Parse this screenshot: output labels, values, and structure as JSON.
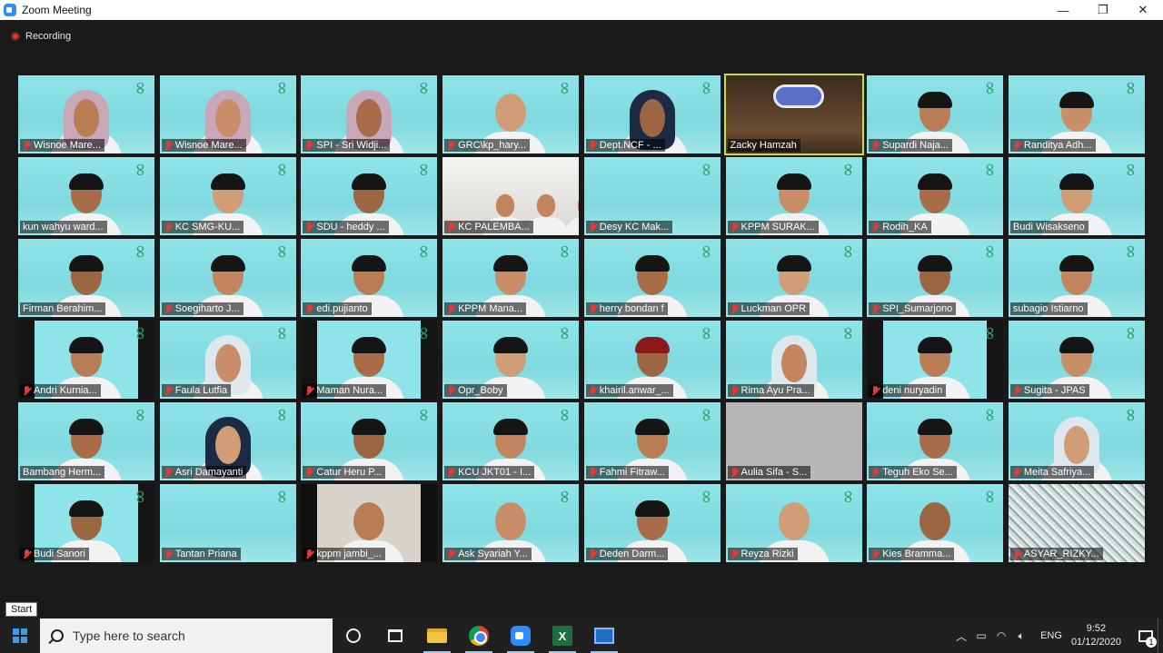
{
  "window": {
    "title": "Zoom Meeting",
    "controls": {
      "minimize": "—",
      "restore": "❐",
      "close": "✕"
    }
  },
  "recording": {
    "label": "Recording"
  },
  "participants": [
    {
      "name": "Wisnoe Mare...",
      "muted": true,
      "look": "hijab"
    },
    {
      "name": "Wisnoe Mare...",
      "muted": true,
      "look": "hijab"
    },
    {
      "name": "SPI - Sri Widji...",
      "muted": true,
      "look": "hijab"
    },
    {
      "name": "GRC\\kp_hary...",
      "muted": true,
      "look": "bare"
    },
    {
      "name": "Dept.NCF - ...",
      "muted": true,
      "look": "hijab-dark"
    },
    {
      "name": "Zacky Hamzah",
      "muted": false,
      "look": "askrindo",
      "active": true
    },
    {
      "name": "Supardi Naja...",
      "muted": true,
      "look": "cap"
    },
    {
      "name": "Randitya Adh...",
      "muted": true,
      "look": "cap"
    },
    {
      "name": "kun wahyu ward...",
      "muted": false,
      "look": "cap"
    },
    {
      "name": "KC SMG-KU...",
      "muted": true,
      "look": "cap"
    },
    {
      "name": "SDU - heddy ...",
      "muted": true,
      "look": "cap"
    },
    {
      "name": "KC PALEMBA...",
      "muted": true,
      "look": "group"
    },
    {
      "name": "Desy KC Mak...",
      "muted": true,
      "look": "empty"
    },
    {
      "name": "KPPM SURAK...",
      "muted": true,
      "look": "cap"
    },
    {
      "name": "Rodih_KA",
      "muted": true,
      "look": "cap"
    },
    {
      "name": "Budi Wisakseno",
      "muted": false,
      "look": "cap"
    },
    {
      "name": "Firman Berahim...",
      "muted": false,
      "look": "cap"
    },
    {
      "name": "Soegiharto J...",
      "muted": true,
      "look": "cap"
    },
    {
      "name": "edi.pujianto",
      "muted": true,
      "look": "cap"
    },
    {
      "name": "KPPM Mana...",
      "muted": true,
      "look": "cap"
    },
    {
      "name": "herry bondan f",
      "muted": true,
      "look": "cap"
    },
    {
      "name": "Luckman OPR",
      "muted": true,
      "look": "cap"
    },
    {
      "name": "SPI_Sumarjono",
      "muted": true,
      "look": "cap"
    },
    {
      "name": "subagio Istiarno",
      "muted": false,
      "look": "cap"
    },
    {
      "name": "Andri Kurnia...",
      "muted": true,
      "look": "cap-dark"
    },
    {
      "name": "Faula Lutfia",
      "muted": true,
      "look": "hijab-light"
    },
    {
      "name": "Maman Nura...",
      "muted": true,
      "look": "cap-dark"
    },
    {
      "name": "Opr_Boby",
      "muted": true,
      "look": "cap"
    },
    {
      "name": "khairil.anwar_...",
      "muted": true,
      "look": "cap-red"
    },
    {
      "name": "Rima Ayu Pra...",
      "muted": true,
      "look": "hijab-light"
    },
    {
      "name": "deni nuryadin",
      "muted": true,
      "look": "cap-dark"
    },
    {
      "name": "Sugita - JPAS",
      "muted": true,
      "look": "cap"
    },
    {
      "name": "Bambang Herm...",
      "muted": false,
      "look": "cap"
    },
    {
      "name": "Asri Damayanti",
      "muted": true,
      "look": "hijab-dark"
    },
    {
      "name": "Catur Heru P...",
      "muted": true,
      "look": "cap"
    },
    {
      "name": "KCU JKT01 - I...",
      "muted": true,
      "look": "cap"
    },
    {
      "name": "Fahmi Fitraw...",
      "muted": true,
      "look": "cap"
    },
    {
      "name": "Aulia Sifa - S...",
      "muted": true,
      "look": "grey"
    },
    {
      "name": "Teguh Eko Se...",
      "muted": true,
      "look": "cap"
    },
    {
      "name": "Meita Safriya...",
      "muted": true,
      "look": "hijab-light"
    },
    {
      "name": "Budi Sanori",
      "muted": true,
      "look": "cap-dark"
    },
    {
      "name": "Tantan Priana",
      "muted": true,
      "look": "empty"
    },
    {
      "name": "kppm jambi_...",
      "muted": true,
      "look": "room"
    },
    {
      "name": "Ask Syariah Y...",
      "muted": true,
      "look": "bare"
    },
    {
      "name": "Deden Darm...",
      "muted": true,
      "look": "cap"
    },
    {
      "name": "Reyza Rizki",
      "muted": true,
      "look": "bare"
    },
    {
      "name": "Kies Bramma...",
      "muted": true,
      "look": "bare"
    },
    {
      "name": "ASYAR_RIZKY...",
      "muted": true,
      "look": "noise"
    }
  ],
  "tooltip": {
    "start": "Start"
  },
  "taskbar": {
    "search_placeholder": "Type here to search",
    "apps": [
      "cortana-icon",
      "task-view-icon",
      "file-explorer-icon",
      "chrome-icon",
      "zoom-icon",
      "excel-icon",
      "photos-icon"
    ],
    "tray": {
      "lang": "ENG",
      "time": "9:52",
      "date": "01/12/2020",
      "notifications": "1"
    }
  },
  "colors": {
    "tile_bg": "#7fd9de",
    "active_border": "#c8dd3a",
    "muted_red": "#e23b35",
    "taskbar": "#202020"
  }
}
